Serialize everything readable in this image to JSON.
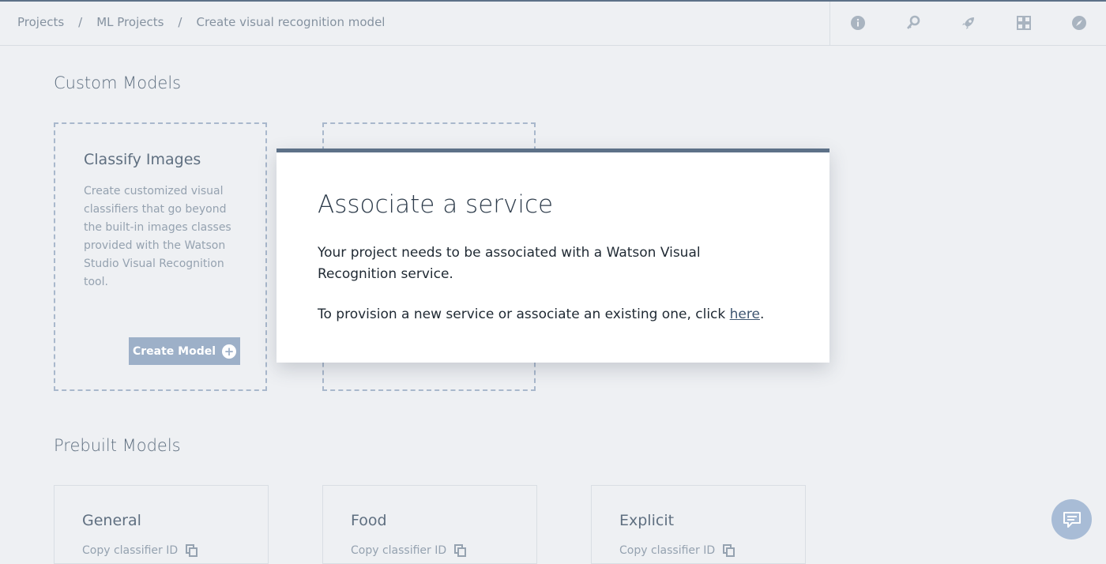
{
  "breadcrumb": [
    "Projects",
    "ML Projects",
    "Create visual recognition model"
  ],
  "header_icons": [
    "info-icon",
    "key-icon",
    "rocket-icon",
    "grid-icon",
    "compass-icon"
  ],
  "custom_models": {
    "title": "Custom Models",
    "classify": {
      "title": "Classify Images",
      "description": "Create customized visual classifiers that go beyond the built-in images classes provided with the Watson Studio Visual Recognition tool.",
      "button_label": "Create Model"
    }
  },
  "modal": {
    "title": "Associate a service",
    "paragraph1": "Your project needs to be associated with a Watson Visual Recognition service.",
    "paragraph2_prefix": "To provision a new service or associate an existing one, click ",
    "paragraph2_link": "here",
    "paragraph2_suffix": "."
  },
  "prebuilt_models": {
    "title": "Prebuilt Models",
    "cards": [
      {
        "title": "General",
        "copy_label": "Copy classifier ID"
      },
      {
        "title": "Food",
        "copy_label": "Copy classifier ID"
      },
      {
        "title": "Explicit",
        "copy_label": "Copy classifier ID"
      }
    ]
  },
  "colors": {
    "accent": "#5d7188",
    "button": "#9db0c8",
    "chat_button": "#a8bcd6",
    "background": "#eef0f3"
  }
}
